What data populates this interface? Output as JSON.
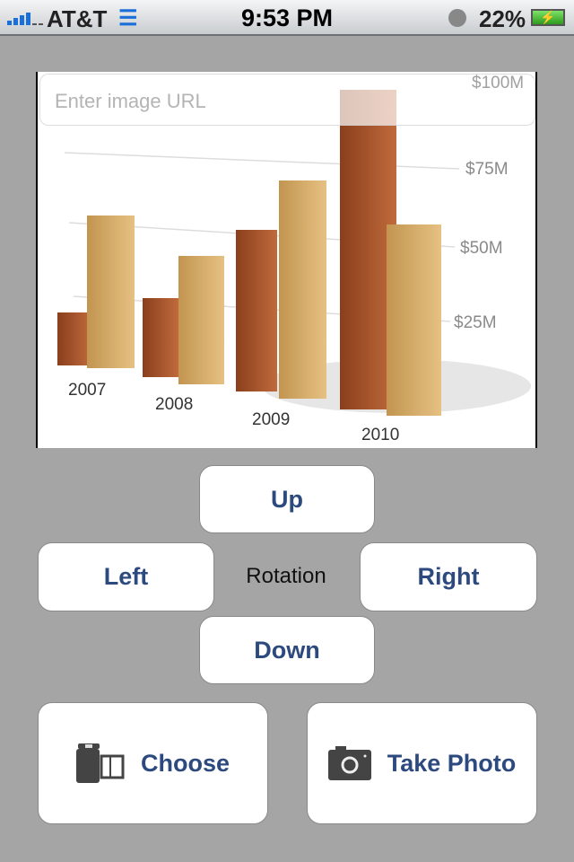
{
  "status_bar": {
    "carrier": "AT&T",
    "time": "9:53 PM",
    "battery": "22%",
    "icons": [
      "signal-icon",
      "wifi-icon",
      "clock-icon",
      "battery-charging-icon"
    ]
  },
  "image": {
    "url_placeholder": "Enter image URL",
    "y_labels": [
      "$100M",
      "$75M",
      "$50M",
      "$25M"
    ],
    "x_labels": [
      "2007",
      "2008",
      "2009",
      "2010"
    ]
  },
  "controls": {
    "up": "Up",
    "left": "Left",
    "rotation": "Rotation",
    "right": "Right",
    "down": "Down"
  },
  "actions": {
    "choose": "Choose",
    "take_photo": "Take Photo",
    "choose_icon": "film-roll-icon",
    "take_photo_icon": "camera-icon"
  },
  "colors": {
    "background": "#a5a5a5",
    "button_text": "#2d4a7f"
  }
}
